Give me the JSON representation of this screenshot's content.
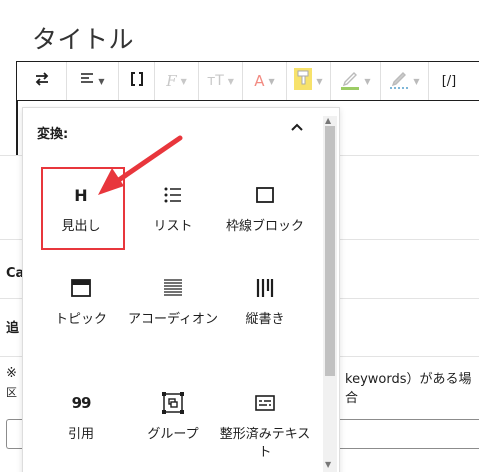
{
  "page_title": "タイトル",
  "toolbar": {
    "transform_icon": "arrows-swap-icon",
    "align_icon": "align-left-icon",
    "bracket_icon": "bracket-icon",
    "text_style_icon": "font-f-icon",
    "text_size_icon": "font-size-icon",
    "text_color_icon": "font-color-icon",
    "highlight_icon": "highlighter-icon",
    "marker_icon": "pen-icon",
    "marker2_icon": "pen-dotted-icon",
    "code_label": "[/]"
  },
  "background": {
    "label_ca": "Ca",
    "label_add": "追",
    "note_mark": "※",
    "keywords_text": "keywords）がある場合",
    "divider_text": "区"
  },
  "popover": {
    "header": "変換:",
    "items": [
      {
        "label": "見出し",
        "icon": "heading-icon",
        "glyph": "H"
      },
      {
        "label": "リスト",
        "icon": "list-icon"
      },
      {
        "label": "枠線ブロック",
        "icon": "bordered-block-icon"
      },
      {
        "label": "トピック",
        "icon": "topic-icon"
      },
      {
        "label": "アコーディオン",
        "icon": "accordion-icon"
      },
      {
        "label": "縦書き",
        "icon": "vertical-text-icon"
      },
      {
        "label": "引用",
        "icon": "quote-icon",
        "glyph": "99"
      },
      {
        "label": "グループ",
        "icon": "group-icon"
      },
      {
        "label": "整形済みテキスト",
        "icon": "preformatted-icon"
      }
    ]
  },
  "colors": {
    "annotation_red": "#e8363c",
    "text": "#1e1e1e",
    "highlight_yellow": "#f7e26b",
    "marker_green": "#9ccc65",
    "text_color_red": "#f28b82"
  }
}
